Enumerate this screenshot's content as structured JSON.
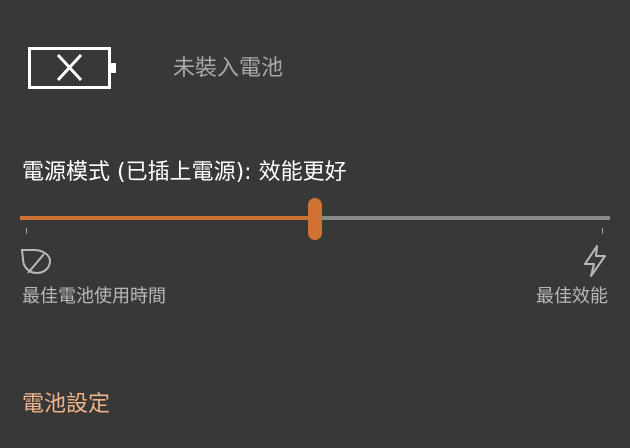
{
  "battery": {
    "status_text": "未裝入電池",
    "icon": "battery-missing-icon"
  },
  "power_mode": {
    "label": "電源模式 (已插上電源): 效能更好",
    "slider_value_fraction": 0.5,
    "left_label": "最佳電池使用時間",
    "right_label": "最佳效能",
    "left_icon": "leaf-icon",
    "right_icon": "lightning-bolt-icon"
  },
  "settings_link": "電池設定",
  "colors": {
    "background": "#383838",
    "accent": "#cf7232",
    "track": "#8a8a8a",
    "link": "#f0b48a"
  }
}
